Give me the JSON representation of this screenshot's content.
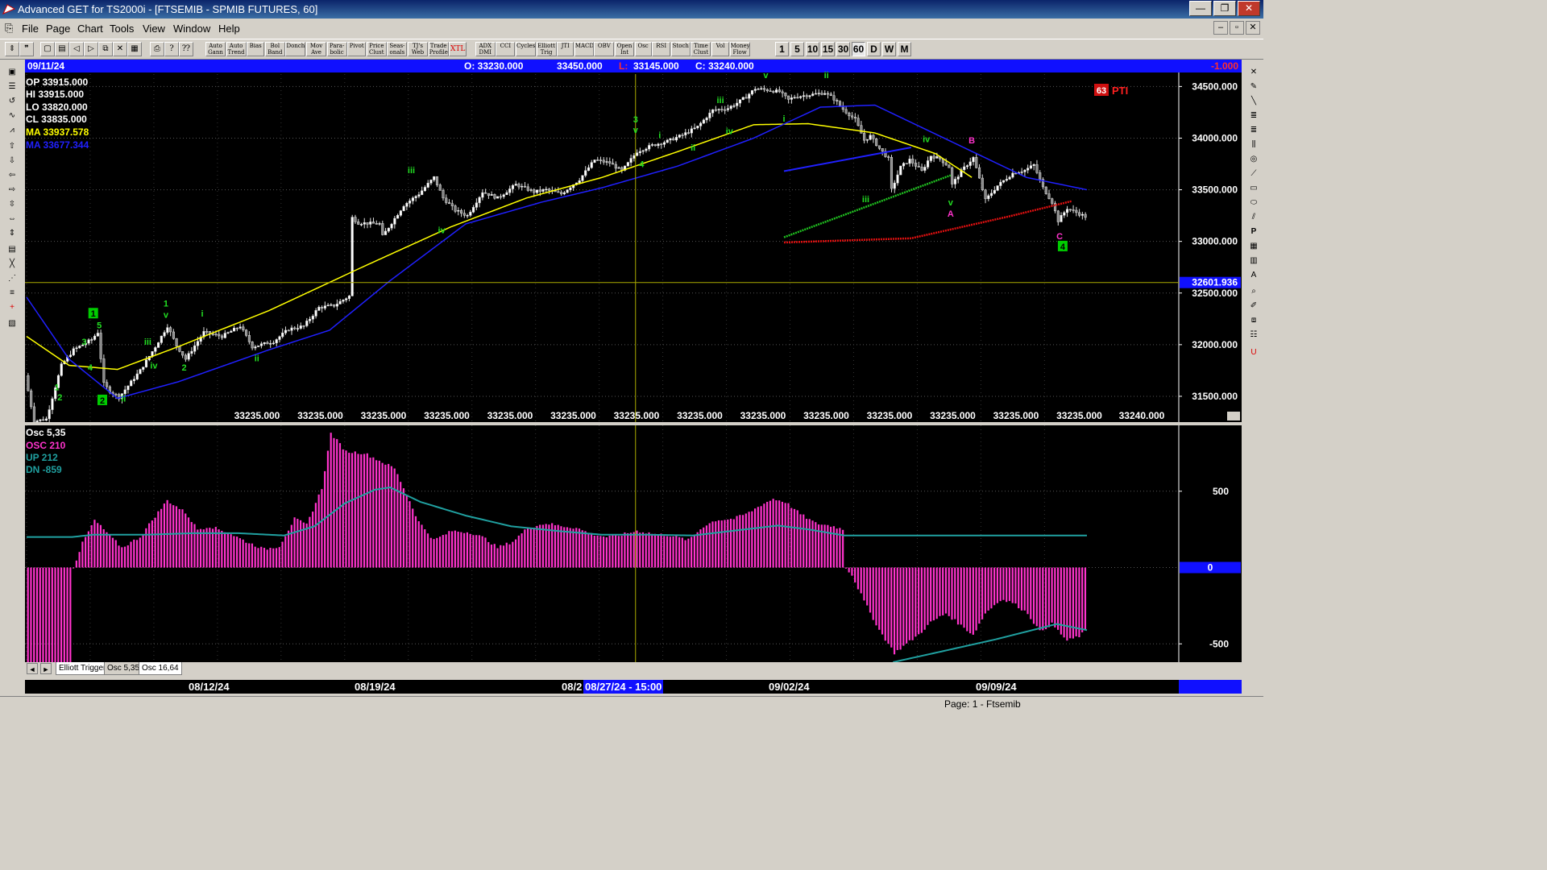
{
  "window": {
    "title": "Advanced GET for TS2000i - [FTSEMIB - SPMIB FUTURES, 60]",
    "buttons": [
      "—",
      "❐",
      "✕"
    ]
  },
  "menu": [
    "File",
    "Page",
    "Chart",
    "Tools",
    "View",
    "Window",
    "Help"
  ],
  "mdi_buttons": [
    "–",
    "▫",
    "✕"
  ],
  "toolbar": {
    "study_buttons": [
      "Auto Gann",
      "Auto Trend",
      "Bias",
      "Bol Band",
      "Donch",
      "Mov Ave",
      "Para-bolic",
      "Pivot",
      "Price Clust",
      "Seas-onals",
      "TJ's Web",
      "Trade Profile",
      "XTL",
      "ADX DMI",
      "CCI",
      "Cycles",
      "Elliott Trig",
      "JTI",
      "MACD",
      "OBV",
      "Open Int",
      "Osc",
      "RSI",
      "Stoch",
      "Time Clust",
      "Vol",
      "Money Flow"
    ],
    "interval_buttons": [
      "1",
      "5",
      "10",
      "15",
      "30",
      "60",
      "D",
      "W",
      "M"
    ],
    "active_interval": "60"
  },
  "header": {
    "date": "09/11/24",
    "open": "O: 33230.000",
    "high": "33450.000",
    "low_label": "L:",
    "low": "33145.000",
    "close": "C: 33240.000",
    "change": "-1.000"
  },
  "readout": {
    "op": "OP  33915.000",
    "hi": "HI   33915.000",
    "lo": "LO  33820.000",
    "cl": "CL  33835.000",
    "ma1": "MA  33937.578",
    "ma2": "MA  33677.344"
  },
  "pti": {
    "value": "63",
    "label": "PTI"
  },
  "price_axis": {
    "labels": [
      "34500.000",
      "34000.000",
      "33500.000",
      "33000.000",
      "32500.000",
      "32000.000",
      "31500.000"
    ],
    "cursor_price": "32601.936",
    "ticks": [
      34500,
      34000,
      33500,
      33000,
      32500,
      32000,
      31500
    ]
  },
  "bottom_values": [
    "33235.000",
    "33235.000",
    "33235.000",
    "33235.000",
    "33235.000",
    "33235.000",
    "33235.000",
    "33235.000",
    "33235.000",
    "33235.000",
    "33235.000",
    "33235.000",
    "33235.000",
    "33235.000"
  ],
  "last_close": "33240.000",
  "osc_readout": {
    "title": "Osc 5,35",
    "osc": "OSC 210",
    "up": "UP   212",
    "dn": "DN   -859"
  },
  "osc_axis": {
    "labels": [
      "500",
      "0",
      "-500"
    ]
  },
  "tabs": [
    "Elliott Trigger",
    "Osc 5,35",
    "Osc 16,64"
  ],
  "tab_arrows": [
    "◄",
    "►"
  ],
  "dates": [
    "08/12/24",
    "08/19/24",
    "08/2",
    "09/02/24",
    "09/09/24"
  ],
  "cursor_date": "08/27/24 - 15:00",
  "status": "Page: 1 - Ftsemib",
  "elliott_labels": [
    {
      "text": "1",
      "c": 10,
      "p": 31560,
      "color": "green"
    },
    {
      "text": "2",
      "c": 11,
      "p": 31460,
      "color": "green"
    },
    {
      "text": "3",
      "c": 19,
      "p": 32000,
      "color": "green"
    },
    {
      "text": "4",
      "c": 21,
      "p": 31750,
      "color": "green"
    },
    {
      "text": "5",
      "c": 24,
      "p": 32160,
      "color": "green"
    },
    {
      "text": "ii",
      "c": 32,
      "p": 31450,
      "color": "green"
    },
    {
      "text": "iii",
      "c": 40,
      "p": 32000,
      "color": "green"
    },
    {
      "text": "iv",
      "c": 42,
      "p": 31770,
      "color": "green"
    },
    {
      "text": "v",
      "c": 46,
      "p": 32260,
      "color": "green"
    },
    {
      "text": "1",
      "c": 46,
      "p": 32370,
      "color": "green"
    },
    {
      "text": "2",
      "c": 52,
      "p": 31750,
      "color": "green"
    },
    {
      "text": "i",
      "c": 58,
      "p": 32270,
      "color": "green"
    },
    {
      "text": "ii",
      "c": 76,
      "p": 31840,
      "color": "green"
    },
    {
      "text": "iii",
      "c": 127,
      "p": 33660,
      "color": "green"
    },
    {
      "text": "iv",
      "c": 137,
      "p": 33080,
      "color": "green"
    },
    {
      "text": "3",
      "c": 201,
      "p": 34150,
      "color": "green"
    },
    {
      "text": "v",
      "c": 201,
      "p": 34050,
      "color": "green"
    },
    {
      "text": "4",
      "c": 203,
      "p": 33720,
      "color": "green"
    },
    {
      "text": "i",
      "c": 209,
      "p": 34000,
      "color": "green"
    },
    {
      "text": "ii",
      "c": 220,
      "p": 33880,
      "color": "green"
    },
    {
      "text": "iii",
      "c": 229,
      "p": 34340,
      "color": "green"
    },
    {
      "text": "iv",
      "c": 232,
      "p": 34040,
      "color": "green"
    },
    {
      "text": "v",
      "c": 244,
      "p": 34580,
      "color": "green"
    },
    {
      "text": "i",
      "c": 250,
      "p": 34160,
      "color": "green"
    },
    {
      "text": "ii",
      "c": 264,
      "p": 34580,
      "color": "green"
    },
    {
      "text": "iii",
      "c": 277,
      "p": 33380,
      "color": "green"
    },
    {
      "text": "iv",
      "c": 297,
      "p": 33960,
      "color": "green"
    },
    {
      "text": "v",
      "c": 305,
      "p": 33350,
      "color": "green"
    },
    {
      "text": "A",
      "c": 305,
      "p": 33240,
      "color": "magenta"
    },
    {
      "text": "B",
      "c": 312,
      "p": 33950,
      "color": "magenta"
    },
    {
      "text": "C",
      "c": 341,
      "p": 33020,
      "color": "magenta"
    }
  ],
  "wave_boxes": [
    {
      "text": "1",
      "c": 22,
      "p": 32270
    },
    {
      "text": "2",
      "c": 25,
      "p": 31430
    },
    {
      "text": "4",
      "c": 342,
      "p": 32920
    }
  ],
  "colors": {
    "background": "#000000",
    "ma_fast": "#ffff00",
    "ma_slow": "#2020ff",
    "osc_bar": "#ff33cc",
    "signal": "#20a0a0",
    "green_channel": "#20c020",
    "red_channel": "#e01010",
    "header": "#1010ff",
    "label_green": "#22dd22",
    "label_magenta": "#ff33cc"
  },
  "chart_data": {
    "type": "candlestick",
    "y_range": [
      31250,
      34620
    ],
    "bar_count": 350,
    "segments": [
      [
        0,
        31700
      ],
      [
        3,
        31260
      ],
      [
        7,
        31280
      ],
      [
        12,
        31800
      ],
      [
        16,
        31950
      ],
      [
        22,
        32050
      ],
      [
        24,
        32120
      ],
      [
        26,
        31620
      ],
      [
        28,
        31550
      ],
      [
        31,
        31490
      ],
      [
        38,
        31750
      ],
      [
        43,
        31980
      ],
      [
        47,
        32180
      ],
      [
        50,
        31990
      ],
      [
        53,
        31860
      ],
      [
        59,
        32120
      ],
      [
        65,
        32080
      ],
      [
        71,
        32180
      ],
      [
        75,
        31980
      ],
      [
        82,
        32030
      ],
      [
        87,
        32150
      ],
      [
        92,
        32180
      ],
      [
        97,
        32360
      ],
      [
        102,
        32380
      ],
      [
        107,
        32470
      ],
      [
        108,
        33230
      ],
      [
        110,
        33180
      ],
      [
        117,
        33170
      ],
      [
        118,
        33050
      ],
      [
        121,
        33180
      ],
      [
        125,
        33350
      ],
      [
        130,
        33460
      ],
      [
        135,
        33620
      ],
      [
        138,
        33420
      ],
      [
        142,
        33300
      ],
      [
        146,
        33250
      ],
      [
        151,
        33480
      ],
      [
        156,
        33420
      ],
      [
        162,
        33550
      ],
      [
        168,
        33480
      ],
      [
        172,
        33500
      ],
      [
        177,
        33460
      ],
      [
        183,
        33600
      ],
      [
        188,
        33790
      ],
      [
        193,
        33760
      ],
      [
        197,
        33680
      ],
      [
        202,
        33870
      ],
      [
        207,
        33930
      ],
      [
        212,
        33970
      ],
      [
        217,
        34030
      ],
      [
        222,
        34110
      ],
      [
        227,
        34270
      ],
      [
        232,
        34290
      ],
      [
        235,
        34340
      ],
      [
        238,
        34400
      ],
      [
        241,
        34480
      ],
      [
        244,
        34470
      ],
      [
        249,
        34450
      ],
      [
        252,
        34370
      ],
      [
        254,
        34400
      ],
      [
        259,
        34420
      ],
      [
        264,
        34440
      ],
      [
        267,
        34380
      ],
      [
        270,
        34280
      ],
      [
        274,
        34180
      ],
      [
        277,
        33980
      ],
      [
        279,
        34020
      ],
      [
        282,
        33900
      ],
      [
        285,
        33800
      ],
      [
        286,
        33500
      ],
      [
        289,
        33720
      ],
      [
        292,
        33790
      ],
      [
        296,
        33680
      ],
      [
        299,
        33830
      ],
      [
        302,
        33800
      ],
      [
        305,
        33720
      ],
      [
        306,
        33550
      ],
      [
        309,
        33680
      ],
      [
        313,
        33810
      ],
      [
        317,
        33400
      ],
      [
        321,
        33540
      ],
      [
        326,
        33660
      ],
      [
        330,
        33690
      ],
      [
        333,
        33740
      ],
      [
        336,
        33520
      ],
      [
        339,
        33380
      ],
      [
        341,
        33200
      ],
      [
        344,
        33320
      ],
      [
        347,
        33280
      ],
      [
        350,
        33240
      ]
    ],
    "ma_fast_points": [
      [
        0,
        32080
      ],
      [
        14,
        31800
      ],
      [
        30,
        31760
      ],
      [
        50,
        31980
      ],
      [
        80,
        32330
      ],
      [
        110,
        32740
      ],
      [
        140,
        33140
      ],
      [
        165,
        33420
      ],
      [
        190,
        33620
      ],
      [
        215,
        33870
      ],
      [
        240,
        34130
      ],
      [
        258,
        34140
      ],
      [
        280,
        34050
      ],
      [
        300,
        33850
      ],
      [
        312,
        33620
      ]
    ],
    "ma_slow_points": [
      [
        0,
        32460
      ],
      [
        14,
        31860
      ],
      [
        30,
        31480
      ],
      [
        50,
        31640
      ],
      [
        80,
        31950
      ],
      [
        100,
        32140
      ],
      [
        120,
        32620
      ],
      [
        145,
        33170
      ],
      [
        170,
        33380
      ],
      [
        190,
        33520
      ],
      [
        215,
        33730
      ],
      [
        240,
        34000
      ],
      [
        262,
        34300
      ],
      [
        280,
        34320
      ],
      [
        305,
        33970
      ],
      [
        330,
        33620
      ],
      [
        350,
        33500
      ]
    ],
    "blue_channel": [
      [
        250,
        33680
      ],
      [
        292,
        33910
      ]
    ],
    "green_channel": [
      [
        250,
        33040
      ],
      [
        305,
        33640
      ]
    ],
    "red_channel": [
      [
        250,
        32990
      ],
      [
        292,
        33030
      ],
      [
        324,
        33240
      ],
      [
        345,
        33390
      ]
    ],
    "cursor": {
      "bar": 201,
      "price": 32601.936
    },
    "oscillator": {
      "y_range": [
        -620,
        900
      ],
      "bars_segments": [
        [
          0,
          -800
        ],
        [
          14,
          -800
        ],
        [
          15,
          0
        ],
        [
          18,
          160
        ],
        [
          22,
          310
        ],
        [
          26,
          230
        ],
        [
          31,
          130
        ],
        [
          37,
          200
        ],
        [
          41,
          310
        ],
        [
          46,
          440
        ],
        [
          52,
          360
        ],
        [
          56,
          250
        ],
        [
          60,
          270
        ],
        [
          66,
          230
        ],
        [
          72,
          170
        ],
        [
          78,
          120
        ],
        [
          83,
          140
        ],
        [
          88,
          320
        ],
        [
          92,
          280
        ],
        [
          97,
          520
        ],
        [
          100,
          880
        ],
        [
          105,
          760
        ],
        [
          111,
          750
        ],
        [
          116,
          700
        ],
        [
          121,
          650
        ],
        [
          125,
          480
        ],
        [
          129,
          300
        ],
        [
          134,
          180
        ],
        [
          140,
          240
        ],
        [
          146,
          230
        ],
        [
          151,
          190
        ],
        [
          155,
          130
        ],
        [
          160,
          170
        ],
        [
          165,
          260
        ],
        [
          171,
          290
        ],
        [
          175,
          275
        ],
        [
          181,
          260
        ],
        [
          186,
          220
        ],
        [
          191,
          200
        ],
        [
          195,
          210
        ],
        [
          201,
          240
        ],
        [
          207,
          220
        ],
        [
          212,
          210
        ],
        [
          218,
          180
        ],
        [
          223,
          270
        ],
        [
          227,
          310
        ],
        [
          233,
          320
        ],
        [
          238,
          360
        ],
        [
          242,
          410
        ],
        [
          246,
          450
        ],
        [
          250,
          430
        ],
        [
          255,
          350
        ],
        [
          260,
          290
        ],
        [
          266,
          270
        ],
        [
          269,
          250
        ],
        [
          270,
          0
        ],
        [
          272,
          -50
        ],
        [
          276,
          -220
        ],
        [
          281,
          -410
        ],
        [
          286,
          -560
        ],
        [
          290,
          -500
        ],
        [
          294,
          -440
        ],
        [
          298,
          -360
        ],
        [
          303,
          -300
        ],
        [
          308,
          -380
        ],
        [
          312,
          -440
        ],
        [
          316,
          -300
        ],
        [
          321,
          -210
        ],
        [
          325,
          -230
        ],
        [
          330,
          -300
        ],
        [
          334,
          -420
        ],
        [
          338,
          -370
        ],
        [
          343,
          -480
        ],
        [
          347,
          -450
        ],
        [
          350,
          -400
        ]
      ],
      "signal_points": [
        [
          0,
          200
        ],
        [
          15,
          200
        ],
        [
          22,
          215
        ],
        [
          40,
          215
        ],
        [
          55,
          225
        ],
        [
          70,
          225
        ],
        [
          85,
          210
        ],
        [
          95,
          270
        ],
        [
          105,
          420
        ],
        [
          115,
          510
        ],
        [
          120,
          525
        ],
        [
          130,
          430
        ],
        [
          145,
          340
        ],
        [
          160,
          270
        ],
        [
          175,
          240
        ],
        [
          190,
          215
        ],
        [
          205,
          215
        ],
        [
          220,
          210
        ],
        [
          235,
          245
        ],
        [
          248,
          275
        ],
        [
          258,
          250
        ],
        [
          270,
          210
        ],
        [
          285,
          210
        ],
        [
          305,
          210
        ],
        [
          330,
          210
        ],
        [
          350,
          210
        ]
      ],
      "signal_lower_points": [
        [
          286,
          -620
        ],
        [
          302,
          -550
        ],
        [
          320,
          -470
        ],
        [
          340,
          -370
        ],
        [
          350,
          -410
        ]
      ]
    }
  }
}
